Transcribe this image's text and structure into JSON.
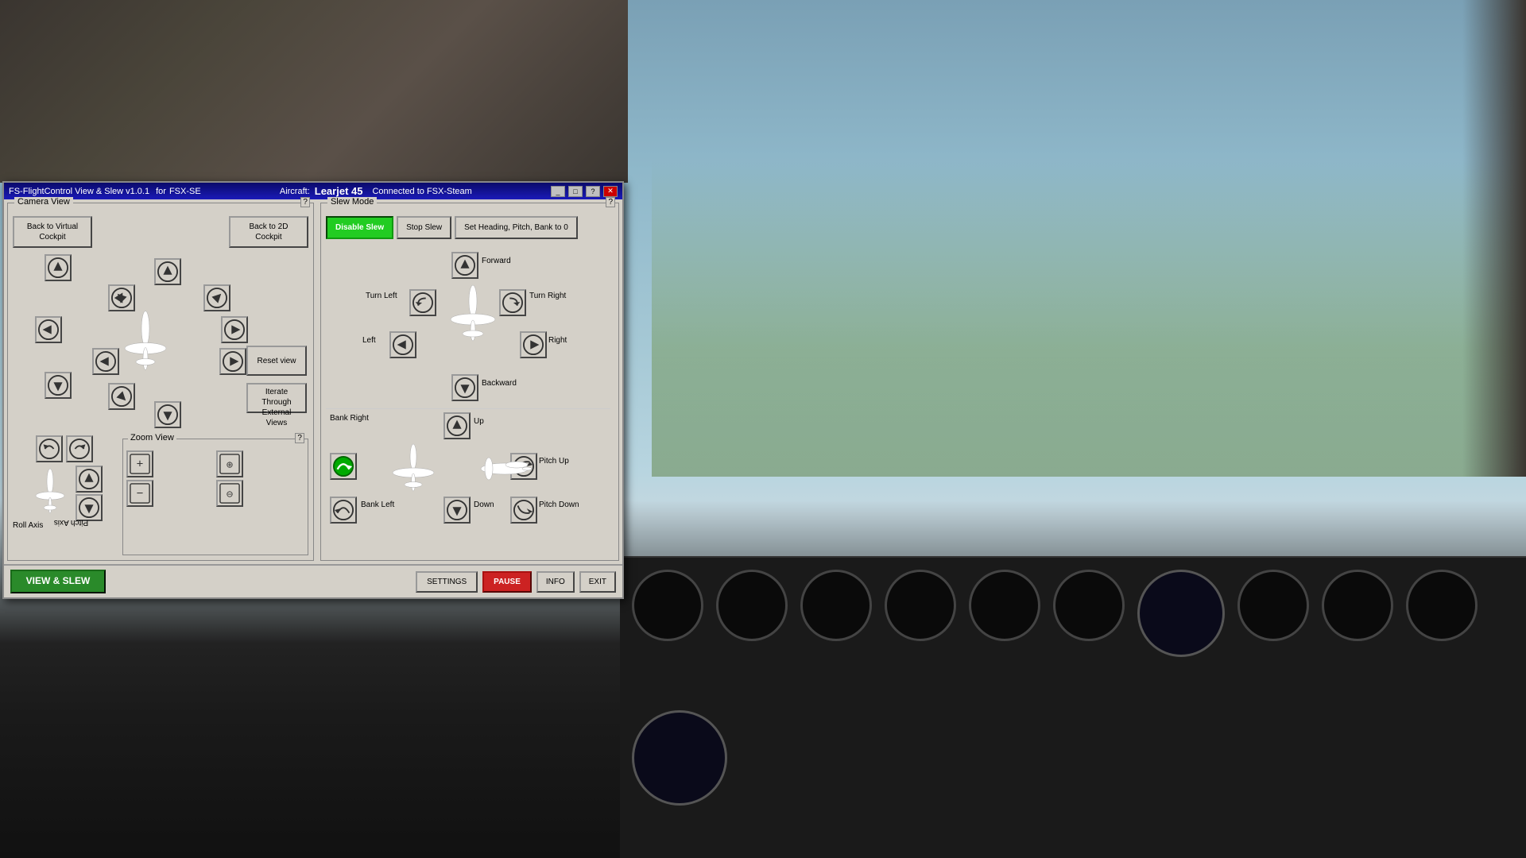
{
  "titlebar": {
    "app_name": "FS-FlightControl View & Slew v1.0.1",
    "for_label": "for",
    "sim_version": "FSX-SE",
    "aircraft_label": "Aircraft:",
    "aircraft_name": "Learjet 45",
    "connected_label": "Connected to FSX-Steam",
    "minimize_label": "_",
    "maximize_label": "□",
    "help_label": "?",
    "close_label": "✕"
  },
  "camera": {
    "section_title": "Camera View",
    "help": "?",
    "back_virtual": "Back to Virtual\nCockpit",
    "back_2d": "Back to 2D\nCockpit",
    "reset_view": "Reset\nview",
    "iterate_external": "Iterate Through\nExternal Views"
  },
  "slew": {
    "section_title": "Slew Mode",
    "help": "?",
    "disable_slew": "Disable Slew",
    "stop_slew": "Stop Slew",
    "set_heading": "Set Heading,\nPitch, Bank to 0",
    "forward_label": "Forward",
    "backward_label": "Backward",
    "turn_left_label": "Turn\nLeft",
    "turn_right_label": "Turn\nRight",
    "left_label": "Left",
    "right_label": "Right",
    "up_label": "Up",
    "down_label": "Down",
    "bank_right_label": "Bank Right",
    "bank_left_label": "Bank Left",
    "pitch_up_label": "Pitch Up",
    "pitch_down_label": "Pitch Down"
  },
  "zoom": {
    "section_title": "Zoom View",
    "help": "?"
  },
  "bottom_bar": {
    "view_slew_label": "VIEW & SLEW",
    "settings_label": "SETTINGS",
    "pause_label": "PAUSE",
    "info_label": "INFO",
    "exit_label": "EXIT"
  },
  "roll_axis_label": "Roll Axis",
  "pitch_axis_label": "Pitch Axis"
}
